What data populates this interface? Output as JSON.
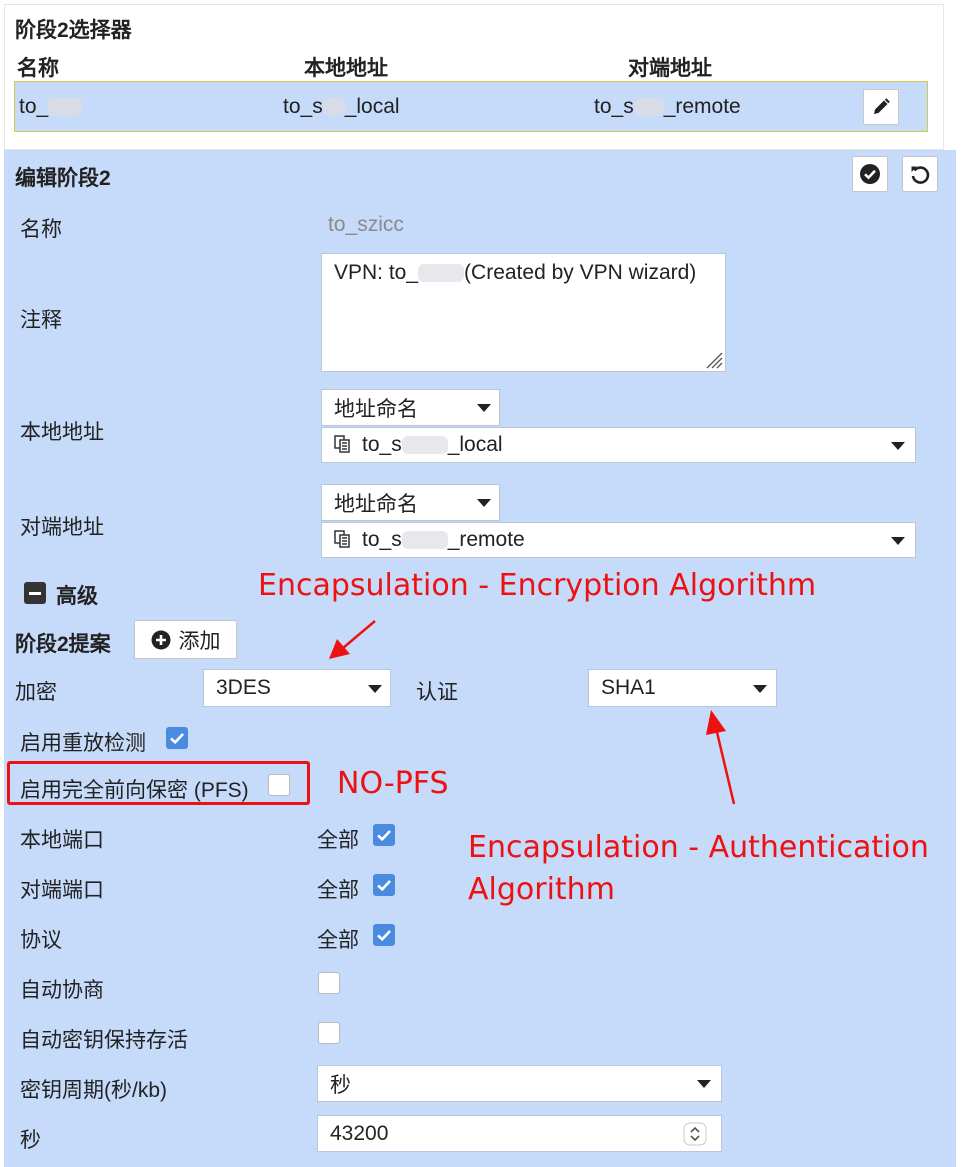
{
  "selector": {
    "title": "阶段2选择器",
    "col_name": "名称",
    "col_local": "本地地址",
    "col_remote": "对端地址",
    "row": {
      "name": "to_",
      "local_prefix": "to_s",
      "local_suffix": "_local",
      "remote_prefix": "to_s",
      "remote_suffix": "_remote"
    }
  },
  "edit": {
    "title": "编辑阶段2",
    "name_label": "名称",
    "name_value": "to_szicc",
    "comment_label": "注释",
    "comment_prefix": "VPN: to_",
    "comment_suffix": "(Created by VPN wizard)",
    "local_addr_label": "本地地址",
    "local_addr_type": "地址命名",
    "local_addr_prefix": "to_s",
    "local_addr_suffix": "_local",
    "remote_addr_label": "对端地址",
    "remote_addr_type": "地址命名",
    "remote_addr_prefix": "to_s",
    "remote_addr_suffix": "_remote",
    "advanced_label": "高级",
    "proposal_label": "阶段2提案",
    "add_label": "添加",
    "encryption_label": "加密",
    "encryption_value": "3DES",
    "auth_label": "认证",
    "auth_value": "SHA1",
    "replay_label": "启用重放检测",
    "replay_checked": true,
    "pfs_label": "启用完全前向保密 (PFS)",
    "pfs_checked": false,
    "local_port_label": "本地端口",
    "remote_port_label": "对端端口",
    "protocol_label": "协议",
    "all_label": "全部",
    "auto_negotiate_label": "自动协商",
    "keepalive_label": "自动密钥保持存活",
    "key_lifetime_label": "密钥周期(秒/kb)",
    "key_lifetime_value": "秒",
    "seconds_label": "秒",
    "seconds_value": "43200"
  },
  "annotations": {
    "enc": "Encapsulation - Encryption Algorithm",
    "nopfs": "NO-PFS",
    "auth_line1": "Encapsulation - Authentication",
    "auth_line2": "Algorithm",
    "color": "#ee1111"
  },
  "colors": {
    "panel": "#c6dafa",
    "checkbox_on": "#4a8be0"
  }
}
